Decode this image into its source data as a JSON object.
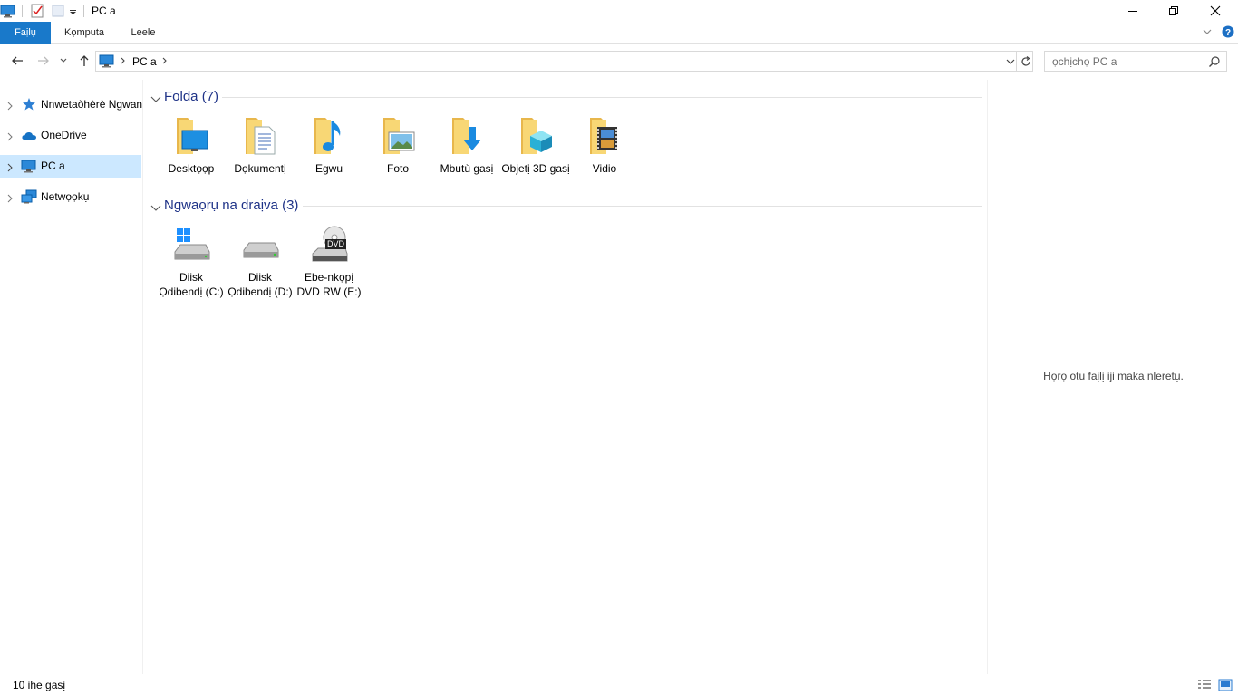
{
  "window": {
    "title": "PC a"
  },
  "ribbon": {
    "tabs": [
      {
        "label": "Faịlụ"
      },
      {
        "label": "Kọmputa"
      },
      {
        "label": "Leele"
      }
    ]
  },
  "address": {
    "location": "PC a"
  },
  "search": {
    "placeholder": "ọchịchọ PC a"
  },
  "navigation": {
    "items": [
      {
        "label": "Nnwetaòhèrè Ngwangwa",
        "icon": "star-icon"
      },
      {
        "label": "OneDrive",
        "icon": "cloud-icon"
      },
      {
        "label": "PC a",
        "icon": "computer-icon",
        "selected": true
      },
      {
        "label": "Netwọọkụ",
        "icon": "network-icon"
      }
    ]
  },
  "groups": {
    "folders": {
      "title": "Folda (7)",
      "items": [
        {
          "label": "Desktọọp",
          "icon": "desktop-folder-icon"
        },
        {
          "label": "Dọkumentị",
          "icon": "documents-folder-icon"
        },
        {
          "label": "Egwu",
          "icon": "music-folder-icon"
        },
        {
          "label": "Foto",
          "icon": "pictures-folder-icon"
        },
        {
          "label": "Mbutù gasị",
          "icon": "downloads-folder-icon"
        },
        {
          "label": "Objetị 3D gasị",
          "icon": "3d-objects-folder-icon"
        },
        {
          "label": "Vidio",
          "icon": "videos-folder-icon"
        }
      ]
    },
    "drives": {
      "title": "Ngwaọrụ na draịva (3)",
      "items": [
        {
          "label": "Diisk Ọdibendị (C:)",
          "icon": "windows-drive-icon"
        },
        {
          "label": "Diisk Ọdibendị (D:)",
          "icon": "drive-icon"
        },
        {
          "label": "Ebe-nkọpị DVD RW (E:)",
          "icon": "dvd-drive-icon",
          "badge": "DVD"
        }
      ]
    }
  },
  "preview": {
    "text": "Họrọ otu faịlị iji maka nleretụ."
  },
  "status": {
    "count": "10 ihe gasị"
  },
  "colors": {
    "accent": "#1979ca",
    "selection": "#cce8ff",
    "group_title": "#1e3287"
  }
}
